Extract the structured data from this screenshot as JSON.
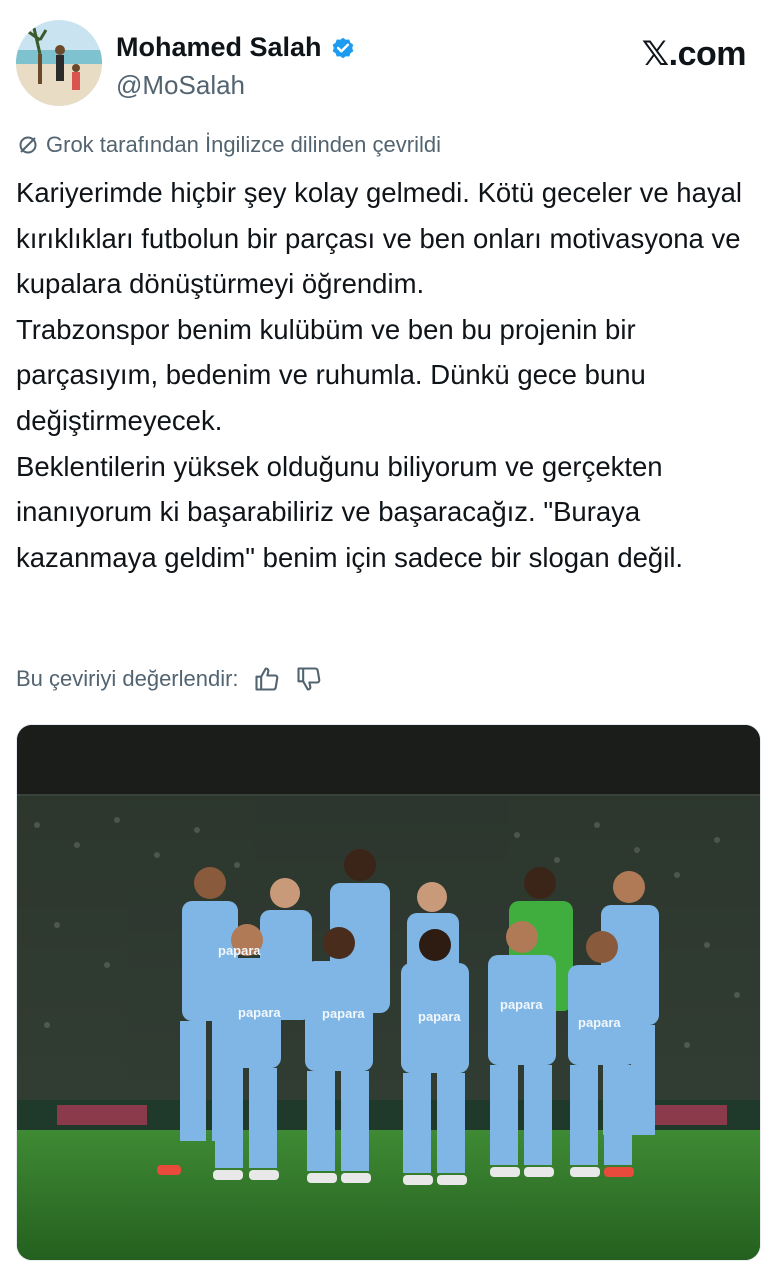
{
  "author": {
    "name": "Mohamed Salah",
    "handle": "@MoSalah",
    "verified": true
  },
  "site": "𝕏.com",
  "translation_notice": "Grok tarafından İngilizce dilinden çevrildi",
  "tweet": {
    "paragraphs": [
      "Kariyerimde hiçbir şey kolay gelmedi. Kötü geceler ve hayal kırıklıkları futbolun bir parçası ve ben onları motivasyona ve kupalara dönüştürmeyi öğrendim.",
      "Trabzonspor benim kulübüm ve ben bu projenin bir parçasıyım, bedenim ve ruhumla. Dünkü gece bunu değiştirmeyecek.",
      "Beklentilerin yüksek olduğunu biliyorum ve gerçekten inanıyorum ki başarabiliriz ve başaracağız. \"Buraya kazanmaya geldim\" benim için sadece bir slogan değil."
    ]
  },
  "rate_translation_label": "Bu çeviriyi değerlendir:",
  "photo": {
    "shirt_sponsor": "papara",
    "colors": {
      "jersey": "#7fb6e6",
      "goalkeeper": "#3fae3f",
      "pitch": "#2f7a2a"
    }
  },
  "icons": {
    "verified": "verified-badge-icon",
    "translate": "translate-slash-icon",
    "like": "thumbs-up-icon",
    "dislike": "thumbs-down-icon"
  },
  "colors": {
    "text": "#0f1419",
    "secondary": "#536471",
    "verified_blue": "#1d9bf0"
  }
}
